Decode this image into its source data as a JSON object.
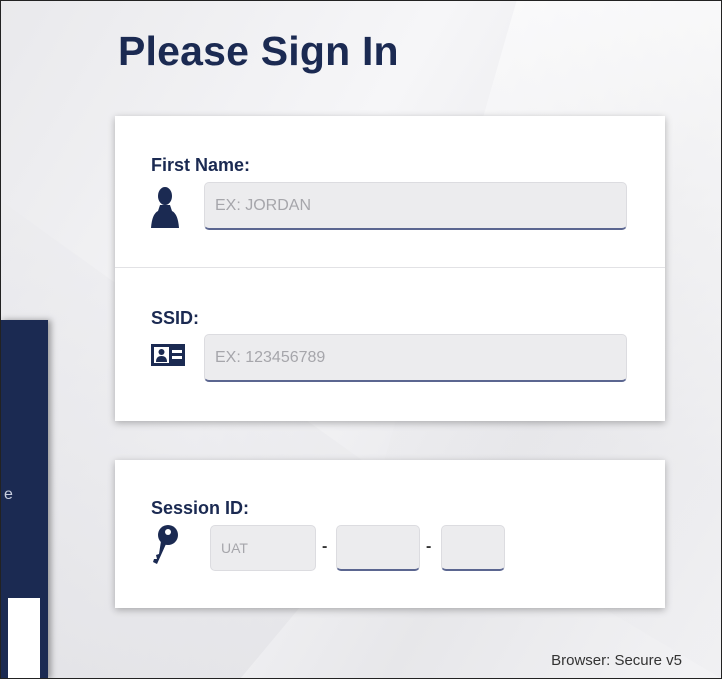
{
  "page": {
    "title": "Please Sign In"
  },
  "form": {
    "first_name": {
      "label": "First Name:",
      "placeholder": "EX: JORDAN",
      "value": ""
    },
    "ssid": {
      "label": "SSID:",
      "placeholder": "EX: 123456789",
      "value": ""
    },
    "session": {
      "label": "Session ID:",
      "part1_placeholder": "UAT",
      "separator": "-"
    }
  },
  "side_panel": {
    "fragment": "e"
  },
  "footer": {
    "browser_text": "Browser: Secure v5"
  },
  "colors": {
    "brand": "#1b2a52",
    "input_bg": "#ececee",
    "input_underline": "#5b6690"
  },
  "icons": {
    "first_name": "person-icon",
    "ssid": "id-card-icon",
    "session": "key-icon"
  }
}
